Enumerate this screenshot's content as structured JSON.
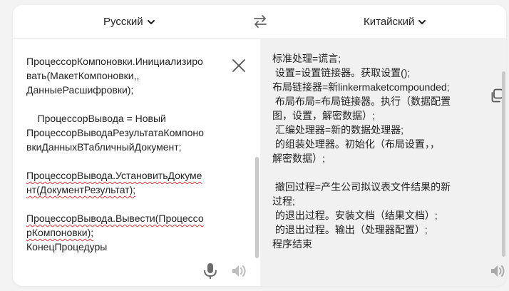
{
  "header": {
    "source_lang": "Русский",
    "target_lang": "Китайский"
  },
  "source": {
    "lines": [
      {
        "text": "ПроцессорКомпоновки.Инициализиро",
        "squiggle": false
      },
      {
        "text": "вать(МакетКомпоновки,,",
        "squiggle": false
      },
      {
        "text": "ДанныеРасшифровки);",
        "squiggle": false
      },
      {
        "text": "",
        "squiggle": false
      },
      {
        "text": "    ПроцессорВывода = Новый",
        "squiggle": false
      },
      {
        "text": "ПроцессорВыводаРезультатаКомпоно",
        "squiggle": false
      },
      {
        "text": "вкиДанныхВТабличныйДокумент;",
        "squiggle": false
      },
      {
        "text": "",
        "squiggle": false
      },
      {
        "text": "ПроцессорВывода.УстановитьДокуме",
        "squiggle": true
      },
      {
        "text": "нт(ДокументРезультат);",
        "squiggle": true
      },
      {
        "text": "",
        "squiggle": false
      },
      {
        "text": "ПроцессорВывода.Вывести(Процессо",
        "squiggle": true
      },
      {
        "text": "рКомпоновки);",
        "squiggle": true
      },
      {
        "text": "КонецПроцедуры",
        "squiggle": false
      }
    ]
  },
  "target": {
    "lines": [
      "标准处理=谎言;",
      " 设置=设置链接器。获取设置();",
      "布局链接器=新linkermaketcompounded;",
      " 布局布局=布局链接器。执行（数据配置",
      "图，设置，解密数据）;",
      " 汇编处理器=新的数据处理器;",
      " 的组装处理器。初始化（布局设置，，",
      "解密数据）;",
      "",
      " 撤回过程=产生公司拟议表文件结果的新",
      "过程;",
      " 的退出过程。安装文档（结果文档）;",
      " 的退出过程。输出（处理器配置）;",
      "程序结束"
    ]
  },
  "icons": {
    "swap": "swap-arrows-icon",
    "clear": "close-icon",
    "copy": "copy-icon",
    "mic": "microphone-icon",
    "speaker": "speaker-icon",
    "chevron": "chevron-down-icon"
  },
  "colors": {
    "squiggle": "#e03131",
    "icon_gray": "#777777",
    "icon_light": "#bdbdbd",
    "target_bg": "#f1f1f1"
  }
}
